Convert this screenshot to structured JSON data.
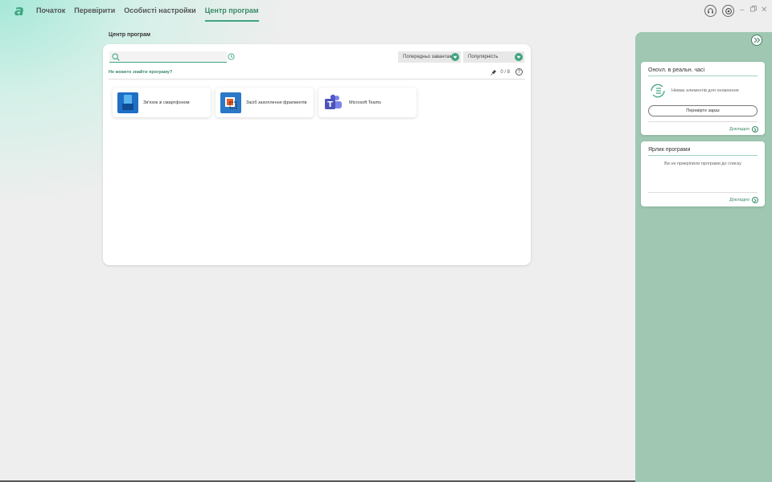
{
  "nav": {
    "items": [
      {
        "label": "Початок",
        "active": false
      },
      {
        "label": "Перевірити",
        "active": false
      },
      {
        "label": "Особисті настройки",
        "active": false
      },
      {
        "label": "Центр програм",
        "active": true
      }
    ]
  },
  "page": {
    "title": "Центр програм"
  },
  "search": {
    "value": "",
    "placeholder": ""
  },
  "filters": {
    "preinstalled": "Попередньо завантаж",
    "sort": "Популярність"
  },
  "cant_find": "Не можете знайти програму?",
  "pin_count": "0 / 8",
  "apps": [
    {
      "label": "Зв'язок зі смартфоном",
      "icon": "phone-link-icon"
    },
    {
      "label": "Засіб захоплення фрагментів",
      "icon": "snipping-tool-icon"
    },
    {
      "label": "Microsoft Teams",
      "icon": "teams-icon"
    }
  ],
  "right_panel": {
    "updates": {
      "title": "Онovл. в реальн. часі",
      "empty": "Немає елементів для оновлення",
      "check_button": "Перевірте зараз",
      "more": "Докладно"
    },
    "shortcuts": {
      "title": "Ярлик програми",
      "empty": "Ви не прикріпили програми до списку",
      "more": "Докладно"
    }
  },
  "colors": {
    "accent": "#3fa57e",
    "panel_bg": "#9fc7b1"
  }
}
